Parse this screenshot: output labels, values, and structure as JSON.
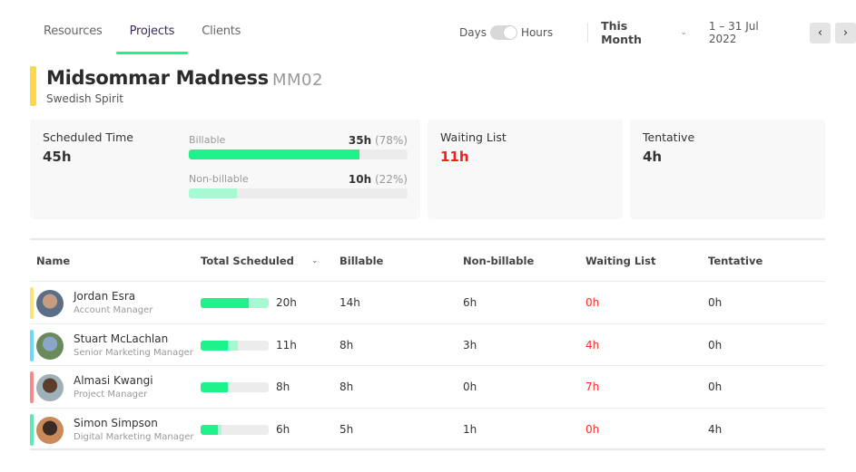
{
  "nav": {
    "tabs": [
      {
        "label": "Resources",
        "active": false
      },
      {
        "label": "Projects",
        "active": true
      },
      {
        "label": "Clients",
        "active": false
      }
    ]
  },
  "controls": {
    "toggle_left": "Days",
    "toggle_right": "Hours",
    "toggle_state": "Hours",
    "period": "This Month",
    "period_icon": "chevron-down-icon",
    "date_range": "1 – 31 Jul 2022",
    "prev_icon": "‹",
    "next_icon": "›"
  },
  "project": {
    "title": "Midsommar Madness",
    "code": "MM02",
    "client": "Swedish Spirit",
    "color": "#f9d949"
  },
  "summary": {
    "scheduled": {
      "title": "Scheduled Time",
      "value": "45h",
      "billable": {
        "label": "Billable",
        "hours": "35h",
        "percent_text": "(78%)",
        "fraction": 0.78,
        "color": "#1ef28a"
      },
      "non_billable": {
        "label": "Non-billable",
        "hours": "10h",
        "percent_text": "(22%)",
        "fraction": 0.22,
        "color": "#a7f9d3"
      }
    },
    "waiting": {
      "title": "Waiting List",
      "value": "11h",
      "color": "#ff1a1a"
    },
    "tentative": {
      "title": "Tentative",
      "value": "4h"
    }
  },
  "table": {
    "columns": {
      "name": "Name",
      "total": "Total Scheduled",
      "billable": "Billable",
      "non_billable": "Non-billable",
      "waiting": "Waiting List",
      "tentative": "Tentative"
    },
    "bar_max_hours": 20,
    "rows": [
      {
        "name": "Jordan Esra",
        "role": "Account Manager",
        "accent": "#fbe27a",
        "avatar_colors": [
          "#5a6f86",
          "#c89c80"
        ],
        "total": "20h",
        "billable_h": 14,
        "non_billable_h": 6,
        "billable": "14h",
        "non_billable": "6h",
        "waiting": "0h",
        "tentative": "0h"
      },
      {
        "name": "Stuart McLachlan",
        "role": "Senior Marketing Manager",
        "accent": "#6fd8f7",
        "avatar_colors": [
          "#6a8a5c",
          "#8aa6c8"
        ],
        "total": "11h",
        "billable_h": 8,
        "non_billable_h": 3,
        "billable": "8h",
        "non_billable": "3h",
        "waiting": "4h",
        "tentative": "0h"
      },
      {
        "name": "Almasi Kwangi",
        "role": "Project Manager",
        "accent": "#fa8a8a",
        "avatar_colors": [
          "#9fb0b8",
          "#5b3d2a"
        ],
        "total": "8h",
        "billable_h": 8,
        "non_billable_h": 0,
        "billable": "8h",
        "non_billable": "0h",
        "waiting": "7h",
        "tentative": "0h"
      },
      {
        "name": "Simon Simpson",
        "role": "Digital Marketing Manager",
        "accent": "#5eeab3",
        "avatar_colors": [
          "#c98a5a",
          "#3a2a24"
        ],
        "total": "6h",
        "billable_h": 5,
        "non_billable_h": 1,
        "billable": "5h",
        "non_billable": "1h",
        "waiting": "0h",
        "tentative": "4h"
      }
    ]
  }
}
